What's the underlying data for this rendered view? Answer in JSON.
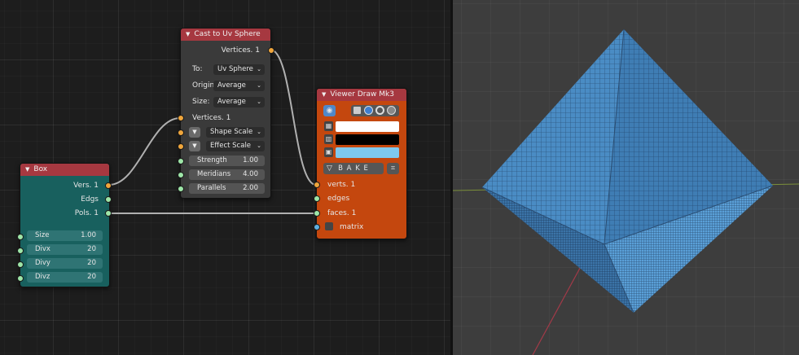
{
  "box_node": {
    "title": "Box",
    "outputs": [
      "Vers. 1",
      "Edgs",
      "Pols. 1"
    ],
    "params": [
      {
        "label": "Size",
        "value": "1.00"
      },
      {
        "label": "Divx",
        "value": "20"
      },
      {
        "label": "Divy",
        "value": "20"
      },
      {
        "label": "Divz",
        "value": "20"
      }
    ]
  },
  "cast_node": {
    "title": "Cast to Uv Sphere",
    "output": "Vertices. 1",
    "to_label": "To:",
    "to_value": "Uv Sphere",
    "origin_label": "Origin",
    "origin_value": "Average",
    "size_label": "Size:",
    "size_value": "Average",
    "vertices_input": "Vertices. 1",
    "shape_scale": "Shape Scale",
    "effect_scale": "Effect Scale",
    "params": [
      {
        "label": "Strength",
        "value": "1.00"
      },
      {
        "label": "Meridians",
        "value": "4.00"
      },
      {
        "label": "Parallels",
        "value": "2.00"
      }
    ]
  },
  "viewer_node": {
    "title": "Viewer Draw Mk3",
    "bake_label": "B A K E",
    "inputs": [
      "verts. 1",
      "edges",
      "faces. 1",
      "matrix"
    ],
    "colors": {
      "vertex": "#ffffff",
      "edge": "#000000",
      "face": "#7ec8ee"
    }
  },
  "colors": {
    "node_header": "#a63840",
    "box_body": "#18605e",
    "viewer_body": "#c4470e",
    "mesh_face": "#4a8cc4",
    "socket_vertex": "#f0a63c",
    "socket_data": "#9ee6a8",
    "socket_matrix": "#5fb0e0"
  }
}
